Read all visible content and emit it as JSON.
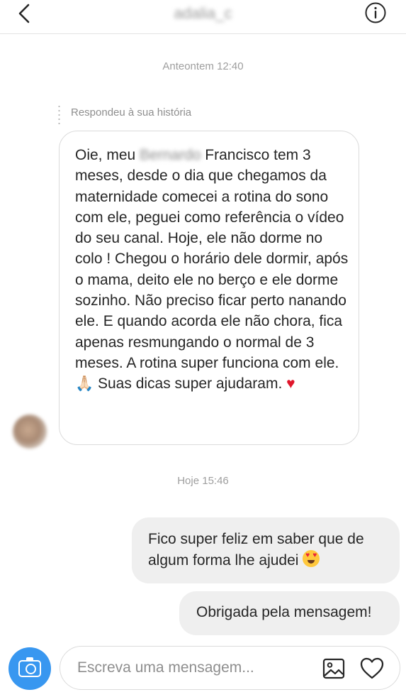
{
  "header": {
    "username": "adalia_c",
    "back_icon": "chevron-left-icon",
    "info_icon": "info-icon"
  },
  "thread": {
    "timestamp_1": "Anteontem 12:40",
    "story_reply_label": "Respondeu à sua história",
    "incoming_message": {
      "part1": "Oie, meu ",
      "blurred_name": "Bernardo",
      "part2": " Francisco tem 3 meses, desde o dia que chegamos da maternidade comecei a rotina do sono com ele, peguei como referência o vídeo do seu canal. Hoje, ele não dorme no colo ! Chegou o horário dele dormir, após o mama, deito ele no berço e ele dorme sozinho. Não preciso ficar perto nanando ele. E quando acorda ele não chora, fica apenas resmungando o normal de 3 meses. A rotina super funciona com ele. ",
      "emoji_1": "🙏🏻",
      "part3": " Suas dicas super ajudaram. ",
      "emoji_2": "♥"
    },
    "timestamp_2": "Hoje 15:46",
    "outgoing_messages": [
      {
        "text": "Fico super feliz em saber que de algum forma lhe ajudei",
        "emoji": "heart-eyes-emoji"
      },
      {
        "text": "Obrigada pela mensagem!"
      }
    ]
  },
  "composer": {
    "placeholder": "Escreva uma mensagem...",
    "value": "",
    "camera_icon": "camera-icon",
    "gallery_icon": "image-icon",
    "like_icon": "heart-outline-icon"
  },
  "colors": {
    "accent": "#3897f0",
    "outgoing_bubble": "#efefef",
    "border": "#dbdbdb",
    "muted_text": "#8e8e8e",
    "heart": "#e0162b"
  }
}
